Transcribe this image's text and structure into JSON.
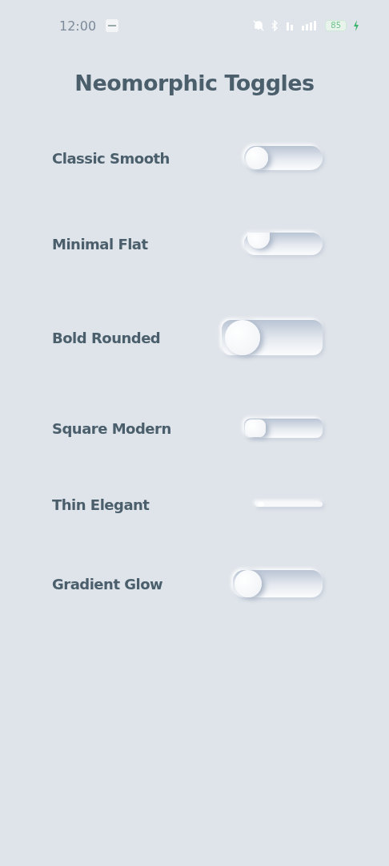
{
  "status_bar": {
    "time": "12:00",
    "battery": "85"
  },
  "title": "Neomorphic Toggles",
  "toggles": [
    {
      "label": "Classic Smooth",
      "kind": "classic",
      "on": false
    },
    {
      "label": "Minimal Flat",
      "kind": "minimal",
      "on": false
    },
    {
      "label": "Bold Rounded",
      "kind": "bold",
      "on": false
    },
    {
      "label": "Square Modern",
      "kind": "square",
      "on": false
    },
    {
      "label": "Thin Elegant",
      "kind": "thin",
      "on": false
    },
    {
      "label": "Gradient Glow",
      "kind": "glow",
      "on": false
    }
  ]
}
